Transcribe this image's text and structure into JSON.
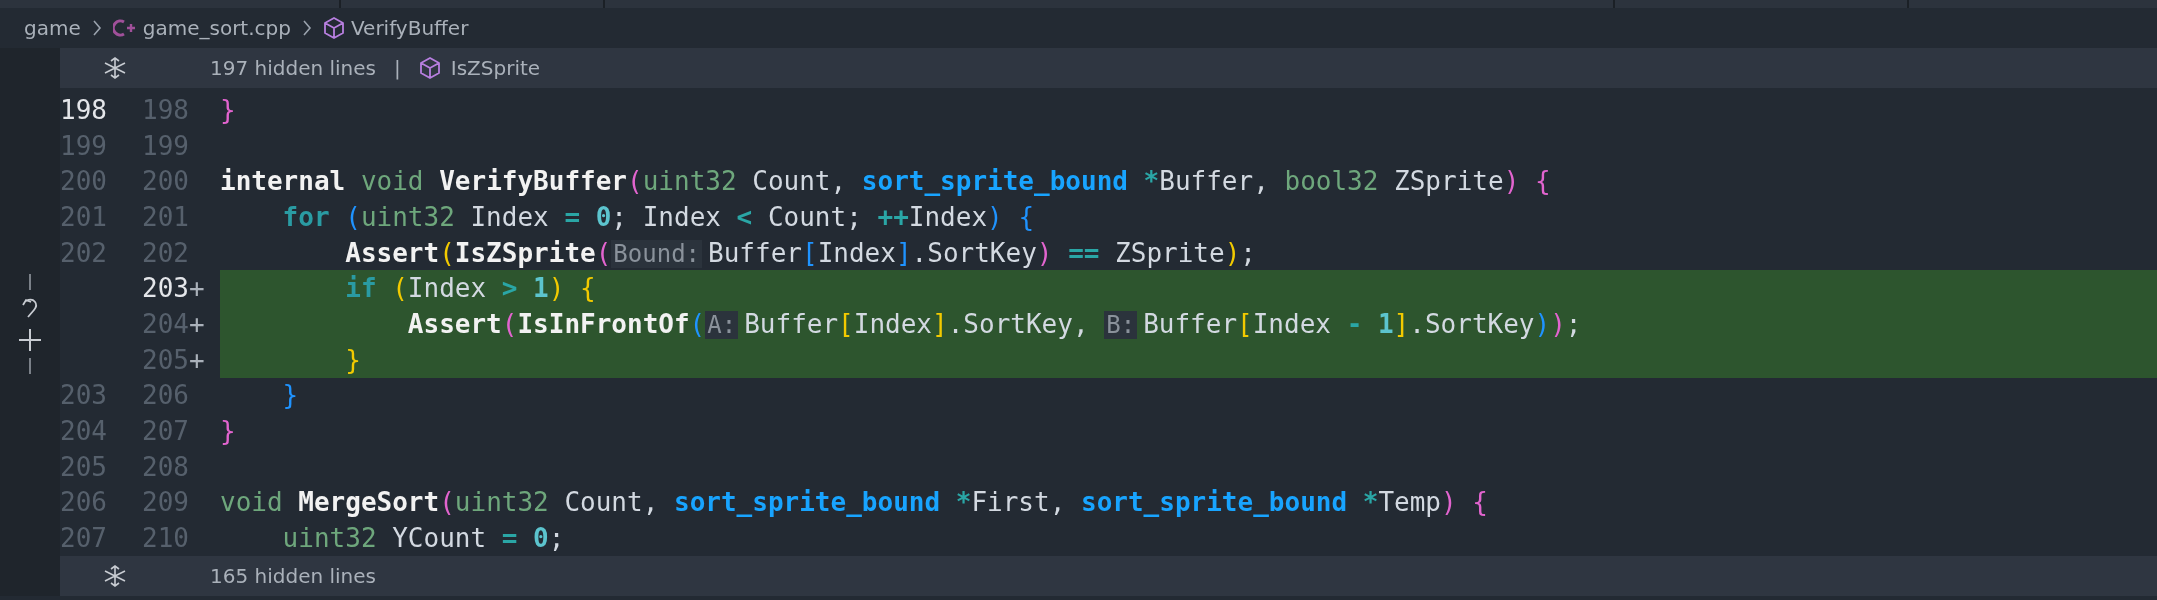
{
  "breadcrumb": [
    {
      "kind": "folder",
      "text": "game"
    },
    {
      "kind": "file",
      "text": "game_sort.cpp"
    },
    {
      "kind": "symbol",
      "text": "VerifyBuffer"
    }
  ],
  "folds_top": {
    "text": "197 hidden lines",
    "separator": "|",
    "symbol": "IsZSprite"
  },
  "lines": [
    {
      "old": "198",
      "old_current": true,
      "new": "198",
      "new_current": false,
      "added": false,
      "tokens": [
        {
          "kind": "b1",
          "text": "}"
        }
      ]
    },
    {
      "old": "199",
      "old_current": false,
      "new": "199",
      "new_current": false,
      "added": false
    },
    {
      "old": "200",
      "old_current": false,
      "new": "200",
      "new_current": false,
      "added": false,
      "tokens": [
        {
          "kind": "keyword",
          "text": "internal "
        },
        {
          "kind": "type",
          "text": "void "
        },
        {
          "kind": "func",
          "text": "VerifyBuffer"
        },
        {
          "kind": "b1",
          "text": "("
        },
        {
          "kind": "type",
          "text": "uint32"
        },
        {
          "kind": "ident",
          "text": " Count, "
        },
        {
          "kind": "struct",
          "text": "sort_sprite_bound "
        },
        {
          "kind": "op",
          "text": "*"
        },
        {
          "kind": "ident",
          "text": "Buffer, "
        },
        {
          "kind": "type",
          "text": "bool32"
        },
        {
          "kind": "ident",
          "text": " ZSprite"
        },
        {
          "kind": "b1",
          "text": ") {"
        }
      ]
    },
    {
      "old": "201",
      "old_current": false,
      "new": "201",
      "new_current": false,
      "added": false,
      "tokens": [
        {
          "kind": "flow",
          "text": "    for "
        },
        {
          "kind": "b3",
          "text": "("
        },
        {
          "kind": "type",
          "text": "uint32"
        },
        {
          "kind": "ident",
          "text": " Index "
        },
        {
          "kind": "op",
          "text": "= "
        },
        {
          "kind": "number",
          "text": "0"
        },
        {
          "kind": "ident",
          "text": "; Index "
        },
        {
          "kind": "op",
          "text": "<"
        },
        {
          "kind": "ident",
          "text": " Count; "
        },
        {
          "kind": "op",
          "text": "++"
        },
        {
          "kind": "ident",
          "text": "Index"
        },
        {
          "kind": "b3",
          "text": ") {"
        }
      ]
    },
    {
      "old": "202",
      "old_current": false,
      "new": "202",
      "new_current": false,
      "added": false,
      "tokens": [
        {
          "kind": "func",
          "text": "        Assert"
        },
        {
          "kind": "b2",
          "text": "("
        },
        {
          "kind": "func",
          "text": "IsZSprite"
        },
        {
          "kind": "b1",
          "text": "("
        },
        {
          "kind": "hint",
          "text": "Bound:"
        },
        {
          "kind": "ident",
          "text": "Buffer"
        },
        {
          "kind": "b3",
          "text": "["
        },
        {
          "kind": "ident",
          "text": "Index"
        },
        {
          "kind": "b3",
          "text": "]"
        },
        {
          "kind": "ident",
          "text": ".SortKey"
        },
        {
          "kind": "b1",
          "text": ") "
        },
        {
          "kind": "op",
          "text": "=="
        },
        {
          "kind": "ident",
          "text": " ZSprite"
        },
        {
          "kind": "b2",
          "text": ")"
        },
        {
          "kind": "ident",
          "text": ";"
        }
      ]
    },
    {
      "new": "203",
      "marker": "+",
      "new_current": true,
      "added": true,
      "tokens": [
        {
          "kind": "flow",
          "text": "        if "
        },
        {
          "kind": "b2",
          "text": "("
        },
        {
          "kind": "ident",
          "text": "Index "
        },
        {
          "kind": "op",
          "text": "> "
        },
        {
          "kind": "number",
          "text": "1"
        },
        {
          "kind": "b2",
          "text": ") {"
        }
      ]
    },
    {
      "new": "204",
      "marker": "+",
      "new_current": false,
      "added": true,
      "tokens": [
        {
          "kind": "func",
          "text": "            Assert"
        },
        {
          "kind": "b1",
          "text": "("
        },
        {
          "kind": "func",
          "text": "IsInFrontOf"
        },
        {
          "kind": "b3",
          "text": "("
        },
        {
          "kind": "hint",
          "text": "A:"
        },
        {
          "kind": "ident",
          "text": "Buffer"
        },
        {
          "kind": "b2",
          "text": "["
        },
        {
          "kind": "ident",
          "text": "Index"
        },
        {
          "kind": "b2",
          "text": "]"
        },
        {
          "kind": "ident",
          "text": ".SortKey, "
        },
        {
          "kind": "hint",
          "text": "B:"
        },
        {
          "kind": "ident",
          "text": "Buffer"
        },
        {
          "kind": "b2",
          "text": "["
        },
        {
          "kind": "ident",
          "text": "Index "
        },
        {
          "kind": "op",
          "text": "- "
        },
        {
          "kind": "number",
          "text": "1"
        },
        {
          "kind": "b2",
          "text": "]"
        },
        {
          "kind": "ident",
          "text": ".SortKey"
        },
        {
          "kind": "b3",
          "text": ")"
        },
        {
          "kind": "b1",
          "text": ")"
        },
        {
          "kind": "ident",
          "text": ";"
        }
      ]
    },
    {
      "new": "205",
      "marker": "+",
      "new_current": false,
      "added": true,
      "tokens": [
        {
          "kind": "b2",
          "text": "        }"
        }
      ]
    },
    {
      "old": "203",
      "old_current": false,
      "new": "206",
      "new_current": false,
      "added": false,
      "tokens": [
        {
          "kind": "b3",
          "text": "    }"
        }
      ]
    },
    {
      "old": "204",
      "old_current": false,
      "new": "207",
      "new_current": false,
      "added": false,
      "tokens": [
        {
          "kind": "b1",
          "text": "}"
        }
      ]
    },
    {
      "old": "205",
      "old_current": false,
      "new": "208",
      "new_current": false,
      "added": false
    },
    {
      "old": "206",
      "old_current": false,
      "new": "209",
      "new_current": false,
      "added": false,
      "tokens": [
        {
          "kind": "type",
          "text": "void "
        },
        {
          "kind": "func",
          "text": "MergeSort"
        },
        {
          "kind": "b1",
          "text": "("
        },
        {
          "kind": "type",
          "text": "uint32"
        },
        {
          "kind": "ident",
          "text": " Count, "
        },
        {
          "kind": "struct",
          "text": "sort_sprite_bound "
        },
        {
          "kind": "op",
          "text": "*"
        },
        {
          "kind": "ident",
          "text": "First, "
        },
        {
          "kind": "struct",
          "text": "sort_sprite_bound "
        },
        {
          "kind": "op",
          "text": "*"
        },
        {
          "kind": "ident",
          "text": "Temp"
        },
        {
          "kind": "b1",
          "text": ") {"
        }
      ]
    },
    {
      "old": "207",
      "old_current": false,
      "new": "210",
      "new_current": false,
      "added": false,
      "tokens": [
        {
          "kind": "type",
          "text": "    uint32"
        },
        {
          "kind": "ident",
          "text": " YCount "
        },
        {
          "kind": "op",
          "text": "= "
        },
        {
          "kind": "number",
          "text": "0"
        },
        {
          "kind": "ident",
          "text": ";"
        }
      ]
    }
  ],
  "folds_bottom": {
    "text": "165 hidden lines"
  }
}
